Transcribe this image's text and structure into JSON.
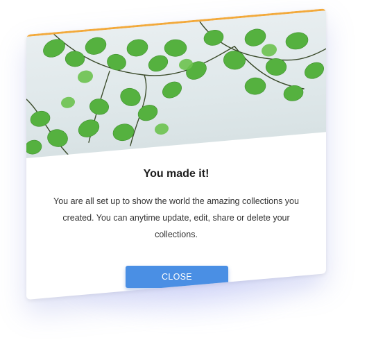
{
  "dialog": {
    "title": "You made it!",
    "message": "You are all set up to show the world the amazing collections you created. You can anytime update, edit, share or delete your collections.",
    "close_label": "CLOSE"
  },
  "colors": {
    "accent_bar": "#f2a93b",
    "button": "#4a8fe4",
    "leaf": "#4fae3a",
    "sky": "#e4ecee"
  },
  "hero_image": {
    "icon": "green-leaves-illustration"
  }
}
